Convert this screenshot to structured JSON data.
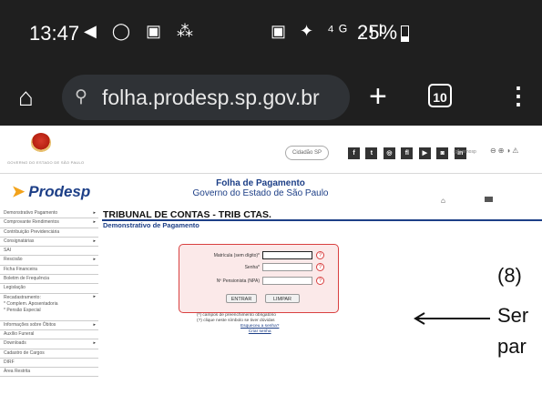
{
  "statusbar": {
    "time": "13:47",
    "left_icons": "◀ ◯ ▣ ⁂",
    "right_icons": "▣ ✦ ⁴ᴳ .ıl",
    "battery": "25%"
  },
  "browser": {
    "url": "folha.prodesp.sp.gov.br",
    "tab_count": "10"
  },
  "site": {
    "crest_caption": "GOVERNO DO ESTADO DE SÃO PAULO",
    "cidade": "Cidadão SP",
    "social": [
      "f",
      "t",
      "◎",
      "fl",
      "▶",
      "◙",
      "in"
    ],
    "gov_label": "/governosp",
    "accessibility": "⊖⊕◑⚠",
    "logo": "Prodesp",
    "title": "Folha de Pagamento",
    "subtitle": "Governo do Estado de São Paulo"
  },
  "sidebar": {
    "items": [
      {
        "label": "Demonstrativo Pagamento",
        "arrow": true
      },
      {
        "label": "Comprovante Rendimentos",
        "arrow": true
      },
      {
        "label": "Contribuição Previdenciária",
        "arrow": false
      },
      {
        "label": "Consignatárias",
        "arrow": true
      },
      {
        "label": "SAI",
        "arrow": false
      },
      {
        "label": "Rescisão",
        "arrow": true
      },
      {
        "label": "Ficha Financeira",
        "arrow": false
      },
      {
        "label": "Boletim de Frequência",
        "arrow": false
      },
      {
        "label": "Legislação",
        "arrow": false
      },
      {
        "label": "Recadastramento:\n* Complem. Aposentadoria\n* Pensão Especial",
        "arrow": true,
        "multi": true
      },
      {
        "label": "Informações sobre Óbitos",
        "arrow": true
      },
      {
        "label": "Auxílio Funeral",
        "arrow": false
      },
      {
        "label": "Downloads",
        "arrow": true
      },
      {
        "label": "Cadastro de Cargos",
        "arrow": false
      },
      {
        "label": "DIRF",
        "arrow": false
      },
      {
        "label": "Área Restrita",
        "arrow": false
      }
    ]
  },
  "main": {
    "title": "TRIBUNAL DE CONTAS - TRIB CTAS.",
    "subtitle": "Demonstrativo de Pagamento",
    "form": {
      "matricula_label": "Matrícula (sem dígito)*",
      "senha_label": "Senha*",
      "pensionista_label": "Nº Pensionista (NPA)",
      "enter_label": "ENTRAR",
      "clear_label": "LIMPAR",
      "help_glyph": "?"
    },
    "notes": [
      "(*) campos de preenchimento obrigatório",
      "(?) clique neste símbolo se tiver dúvidas"
    ],
    "links": [
      "Esqueceu a senha?",
      "Criar senha"
    ]
  },
  "annotation": {
    "number": "(8)",
    "line1": "Ser",
    "line2": "par"
  }
}
